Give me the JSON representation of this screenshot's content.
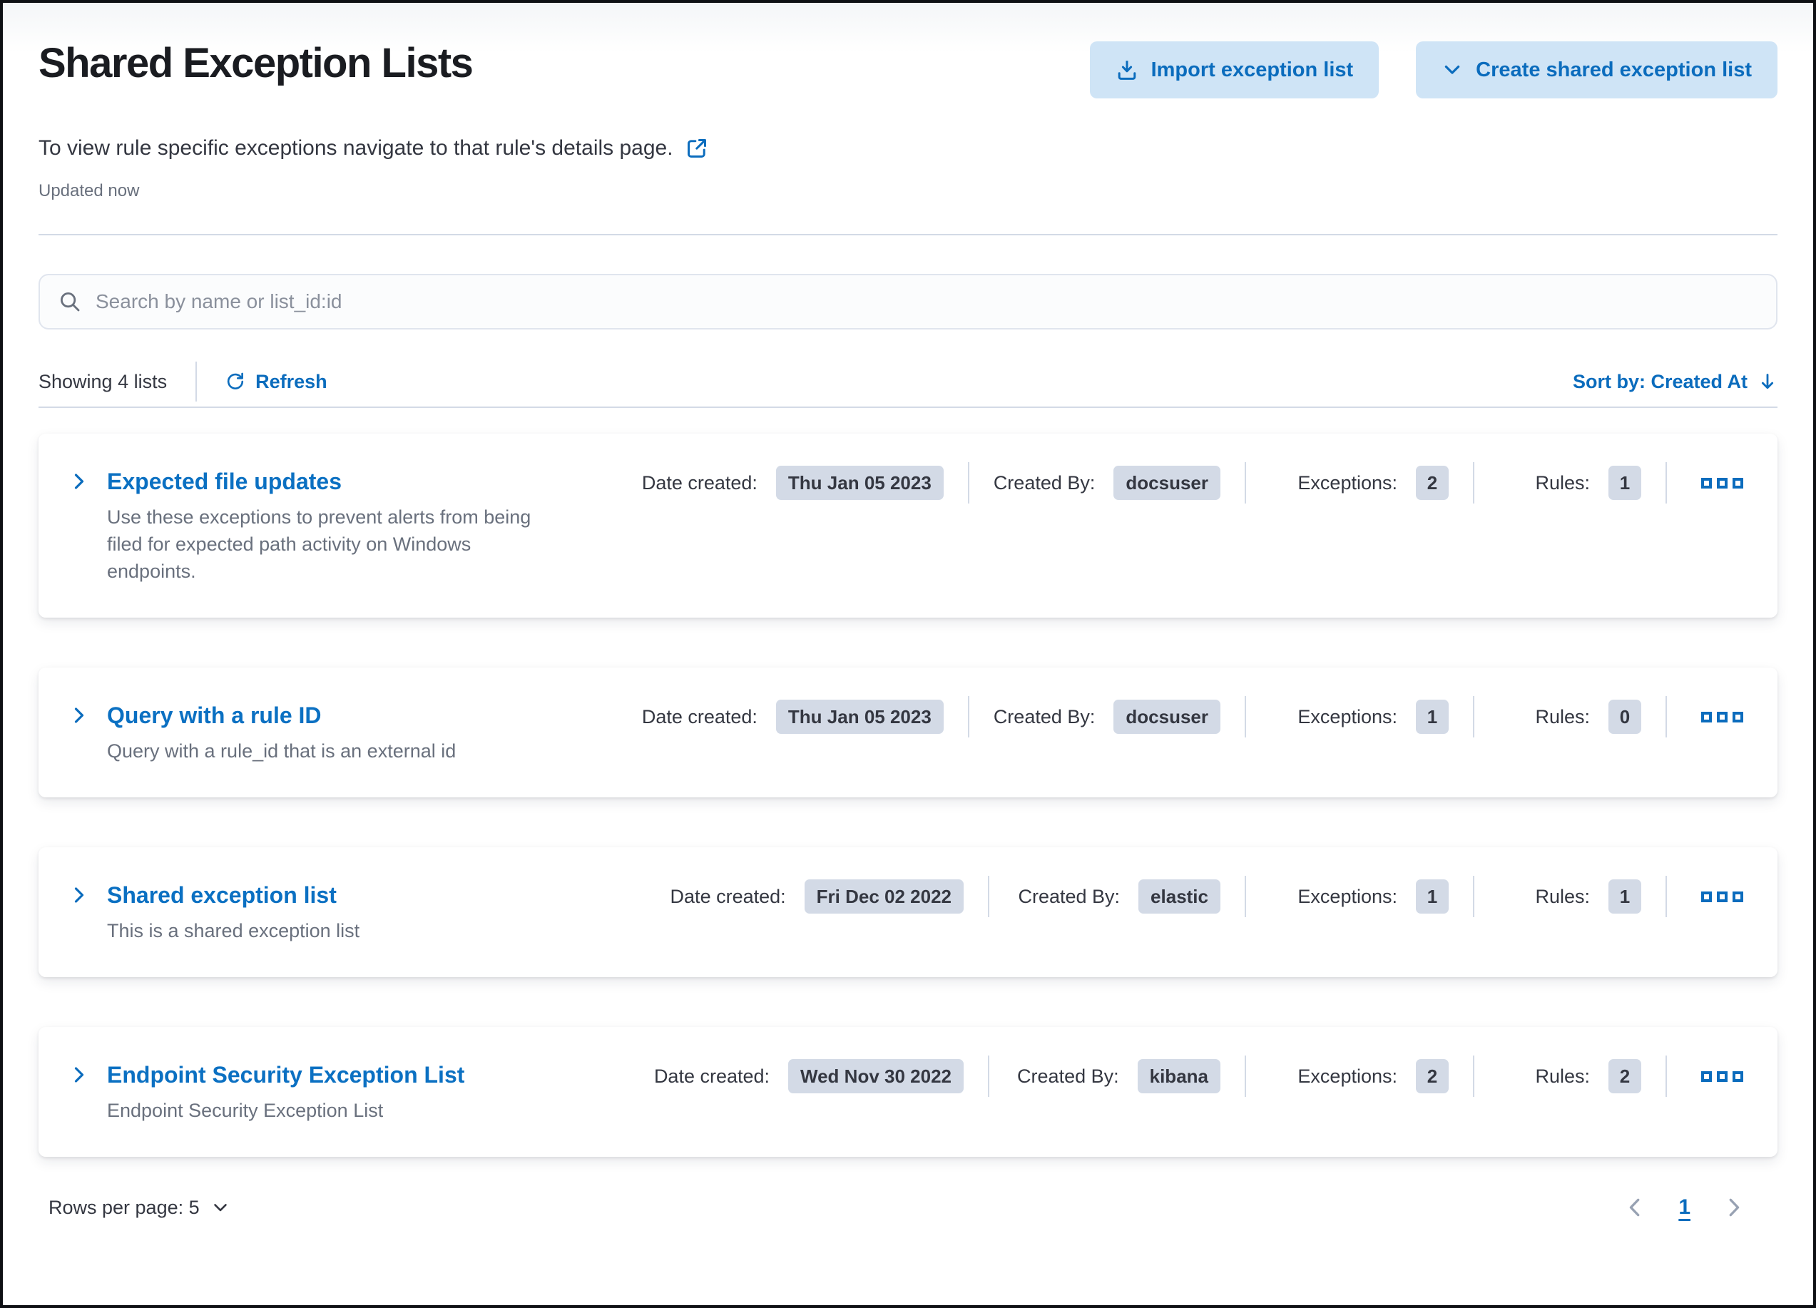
{
  "page": {
    "title": "Shared Exception Lists",
    "subtitle": "To view rule specific exceptions navigate to that rule's details page.",
    "updated_text": "Updated now"
  },
  "actions": {
    "import_label": "Import exception list",
    "create_label": "Create shared exception list"
  },
  "search": {
    "placeholder": "Search by name or list_id:id"
  },
  "utility": {
    "showing_text": "Showing 4 lists",
    "refresh_label": "Refresh",
    "sort_label": "Sort by: Created At"
  },
  "labels": {
    "date_created": "Date created:",
    "created_by": "Created By:",
    "exceptions": "Exceptions:",
    "rules": "Rules:"
  },
  "cards": [
    {
      "title": "Expected file updates",
      "description": "Use these exceptions to prevent alerts from being filed for expected path activity on Windows endpoints.",
      "date_created": "Thu Jan 05 2023",
      "created_by": "docsuser",
      "exceptions": "2",
      "rules": "1"
    },
    {
      "title": "Query with a rule ID",
      "description": "Query with a rule_id that is an external id",
      "date_created": "Thu Jan 05 2023",
      "created_by": "docsuser",
      "exceptions": "1",
      "rules": "0"
    },
    {
      "title": "Shared exception list",
      "description": "This is a shared exception list",
      "date_created": "Fri Dec 02 2022",
      "created_by": "elastic",
      "exceptions": "1",
      "rules": "1"
    },
    {
      "title": "Endpoint Security Exception List",
      "description": "Endpoint Security Exception List",
      "date_created": "Wed Nov 30 2022",
      "created_by": "kibana",
      "exceptions": "2",
      "rules": "2"
    }
  ],
  "footer": {
    "rows_per_page_label": "Rows per page: 5",
    "current_page": "1"
  },
  "icons": {
    "import": "download-into-tray",
    "create_menu": "chevron-down",
    "subtitle_link": "external-link-popout",
    "search": "magnifier",
    "refresh": "circular-arrow",
    "card_expand": "chevron-right",
    "more_actions": "three-boxes-horizontal",
    "sort_direction": "arrow-down",
    "pagination_prev": "chevron-left",
    "pagination_next": "chevron-right",
    "rows_per_page": "chevron-down"
  },
  "colors": {
    "primary_blue": "#0b6cbd",
    "button_bg": "#cfe4f6",
    "badge_bg": "#d3dae6",
    "text_primary": "#343741",
    "text_muted": "#69707d",
    "divider": "#d3dae6"
  }
}
